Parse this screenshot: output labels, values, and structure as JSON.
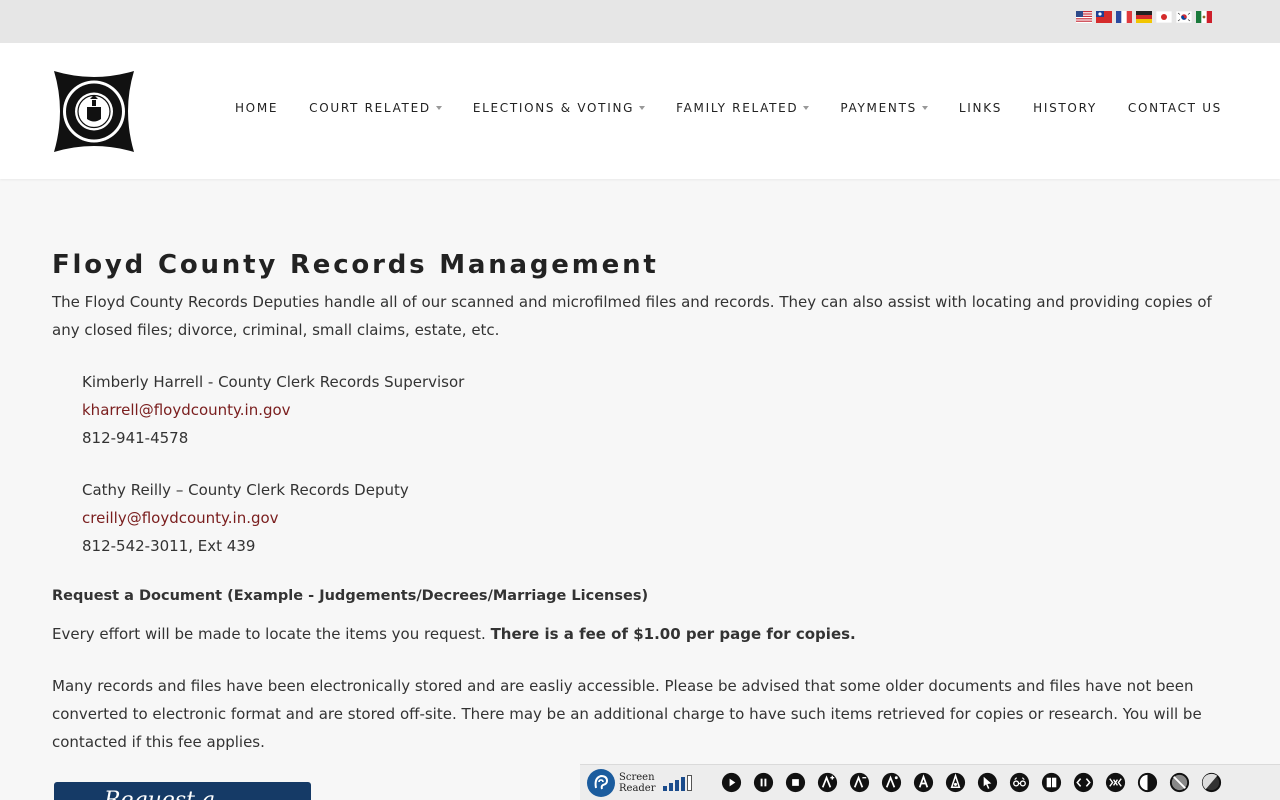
{
  "flags": [
    "us-flag-icon",
    "taiwan-flag-icon",
    "france-flag-icon",
    "germany-flag-icon",
    "japan-flag-icon",
    "korea-flag-icon",
    "mexico-flag-icon"
  ],
  "nav": [
    {
      "label": "HOME",
      "dropdown": false
    },
    {
      "label": "COURT RELATED",
      "dropdown": true
    },
    {
      "label": "ELECTIONS & VOTING",
      "dropdown": true
    },
    {
      "label": "FAMILY RELATED",
      "dropdown": true
    },
    {
      "label": "PAYMENTS",
      "dropdown": true
    },
    {
      "label": "LINKS",
      "dropdown": false
    },
    {
      "label": "HISTORY",
      "dropdown": false
    },
    {
      "label": "CONTACT US",
      "dropdown": false
    }
  ],
  "page": {
    "title": "Floyd County Records Management",
    "intro": "The Floyd County Records Deputies handle all of our scanned and microfilmed files and records.  They can also assist with locating and providing copies of any closed files; divorce, criminal, small claims, estate, etc.",
    "contacts": [
      {
        "name": "Kimberly Harrell - County Clerk Records Supervisor",
        "email": "kharrell@floydcounty.in.gov",
        "phone": "812-941-4578"
      },
      {
        "name": "Cathy Reilly – County Clerk Records Deputy",
        "email": "creilly@floydcounty.in.gov",
        "phone": "812-542-3011, Ext 439"
      }
    ],
    "request_heading": "Request a Document (Example - Judgements/Decrees/Marriage Licenses)",
    "effort_text": "Every effort will be made to locate the items you request. ",
    "fee_text": "There is a fee of $1.00 per page for copies.",
    "records_text": "Many records and files have been electronically stored and are easliy accessible. Please be advised that some older documents and files have not been converted to electronic format and are stored off-site. There may be an additional charge to have such items retrieved for copies or research. You will be contacted if this fee applies.",
    "request_button_label": "Request a"
  },
  "accessibility": {
    "screen_reader_line1": "Screen",
    "screen_reader_line2": "Reader",
    "volume_level": 0.8,
    "tools": [
      "play-icon",
      "pause-icon",
      "stop-icon",
      "increase-text-icon",
      "decrease-text-icon",
      "text-spacing-icon",
      "font-icon",
      "highlight-links-icon",
      "big-cursor-icon",
      "reading-glasses-icon",
      "reading-mode-icon",
      "highlight-headings-icon",
      "disable-styles-icon",
      "contrast-icon",
      "grayscale-icon",
      "invert-icon"
    ]
  }
}
